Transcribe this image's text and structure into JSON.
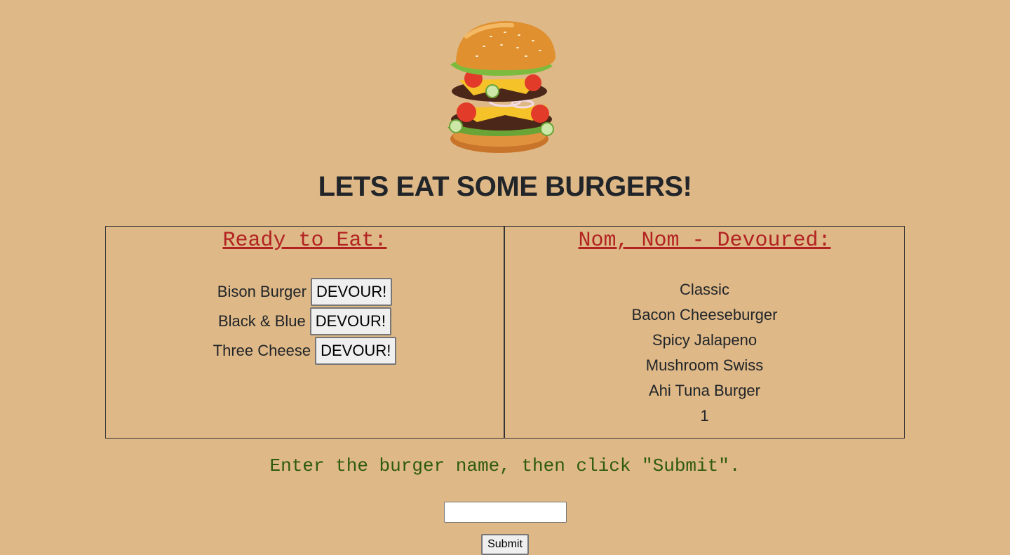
{
  "header": {
    "logo_icon": "stacked-burger-icon",
    "title": "LETS EAT SOME BURGERS!"
  },
  "ready": {
    "heading": "Ready to Eat:",
    "items": [
      {
        "name": "Bison Burger",
        "button": "DEVOUR!"
      },
      {
        "name": "Black & Blue",
        "button": "DEVOUR!"
      },
      {
        "name": "Three Cheese",
        "button": "DEVOUR!"
      }
    ]
  },
  "devoured": {
    "heading": "Nom, Nom - Devoured:",
    "items": [
      "Classic",
      "Bacon Cheeseburger",
      "Spicy Jalapeno",
      "Mushroom Swiss",
      "Ahi Tuna Burger",
      "1"
    ]
  },
  "form": {
    "instructions": "Enter the burger name, then click \"Submit\".",
    "input_value": "",
    "submit_label": "Submit"
  },
  "colors": {
    "background": "#deb887",
    "heading_accent": "#b22222",
    "instruction_text": "#2e5a10"
  }
}
